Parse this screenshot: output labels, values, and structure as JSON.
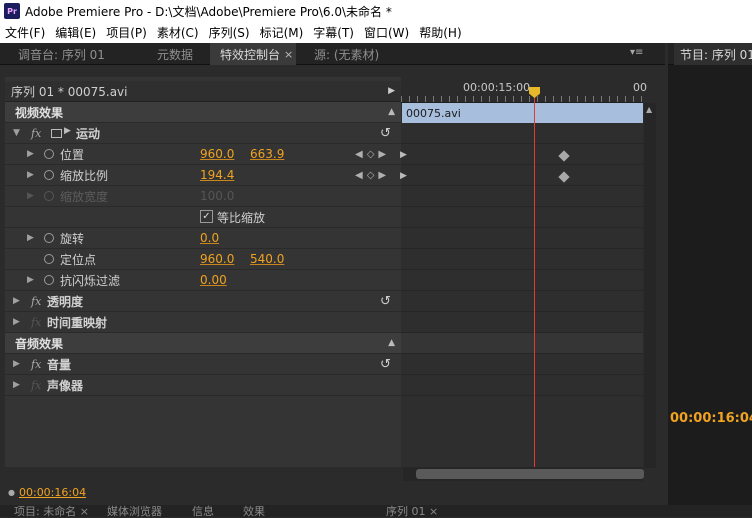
{
  "window": {
    "title": "Adobe Premiere Pro - D:\\文档\\Adobe\\Premiere Pro\\6.0\\未命名 *",
    "app_icon": "Pr"
  },
  "menu": [
    "文件(F)",
    "编辑(E)",
    "项目(P)",
    "素材(C)",
    "序列(S)",
    "标记(M)",
    "字幕(T)",
    "窗口(W)",
    "帮助(H)"
  ],
  "tabs": {
    "mixer": "调音台: 序列 01",
    "metadata": "元数据",
    "effect_controls": "特效控制台",
    "close": "×",
    "source": "源: (无素材)",
    "program": "节目: 序列 01"
  },
  "effects": {
    "sequence_clip": "序列 01 * 00075.avi",
    "ruler_timecode": "00:00:15:00",
    "ruler_end": "00",
    "clip_name": "00075.avi",
    "video_header": "视频效果",
    "motion": "运动",
    "position": {
      "label": "位置",
      "x": "960.0",
      "y": "663.9"
    },
    "scale": {
      "label": "缩放比例",
      "value": "194.4"
    },
    "scale_width": {
      "label": "缩放宽度",
      "value": "100.0"
    },
    "uniform_scale": "等比缩放",
    "uniform_scale_checked": true,
    "rotation": {
      "label": "旋转",
      "value": "0.0"
    },
    "anchor": {
      "label": "定位点",
      "x": "960.0",
      "y": "540.0"
    },
    "anti_flicker": {
      "label": "抗闪烁过滤",
      "value": "0.00"
    },
    "opacity": "透明度",
    "time_remap": "时间重映射",
    "audio_header": "音频效果",
    "volume": "音量",
    "panner": "声像器",
    "fx_symbol": "fx",
    "current_time": "00:00:16:04"
  },
  "program_monitor": {
    "timecode": "00:00:16:04"
  },
  "bottom_tabs": [
    "项目: 未命名 ×",
    "媒体浏览器",
    "信息",
    "效果",
    "序列 01 ×"
  ],
  "colors": {
    "accent_value": "#f0a321",
    "playhead": "#e53a2e",
    "clip": "#a7bfdc"
  }
}
